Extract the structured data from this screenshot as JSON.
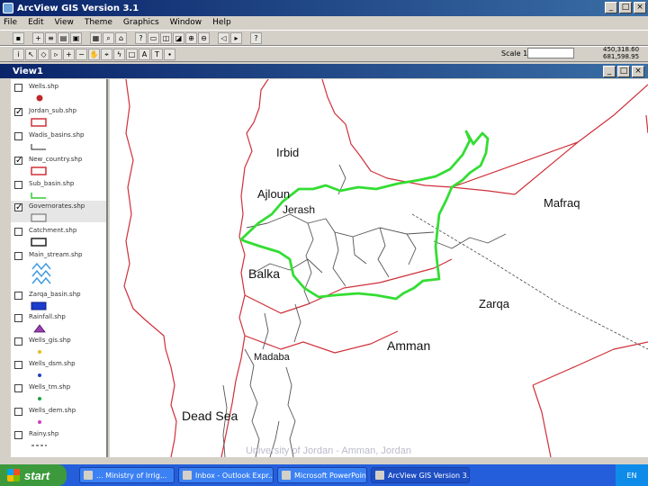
{
  "window": {
    "title": "ArcView GIS Version 3.1"
  },
  "menu": [
    "File",
    "Edit",
    "View",
    "Theme",
    "Graphics",
    "Window",
    "Help"
  ],
  "toolbar": {
    "scale_label": "Scale 1:",
    "coords": [
      "450,318.60",
      "681,598.95"
    ]
  },
  "view": {
    "title": "View1"
  },
  "layers": [
    {
      "label": "Wells.shp",
      "checked": false,
      "symbol": "red-dot"
    },
    {
      "label": "Jordan_sub.shp",
      "checked": true,
      "symbol": "red-rect"
    },
    {
      "label": "Wadis_basins.shp",
      "checked": false,
      "symbol": "black-line"
    },
    {
      "label": "New_country.shp",
      "checked": true,
      "symbol": "red-rect"
    },
    {
      "label": "Sub_basin.shp",
      "checked": false,
      "symbol": "green-line"
    },
    {
      "label": "Governorates.shp",
      "checked": true,
      "symbol": "gray-rect"
    },
    {
      "label": "Catchment.shp",
      "checked": false,
      "symbol": "black-rect"
    },
    {
      "label": "Main_stream.shp",
      "checked": false,
      "symbol": "blue-wave"
    },
    {
      "label": "Zarqa_basin.shp",
      "checked": false,
      "symbol": "blue-fill"
    },
    {
      "label": "Rainfall.shp",
      "checked": false,
      "symbol": "purple-triangle"
    },
    {
      "label": "Wells_gis.shp",
      "checked": false,
      "symbol": "yellow-dot"
    },
    {
      "label": "Wells_dsm.shp",
      "checked": false,
      "symbol": "blue-dot"
    },
    {
      "label": "Wells_tm.shp",
      "checked": false,
      "symbol": "green-dot"
    },
    {
      "label": "Wells_dem.shp",
      "checked": false,
      "symbol": "magenta-dot"
    },
    {
      "label": "Rainy.shp",
      "checked": false,
      "symbol": "dashed-line"
    }
  ],
  "map": {
    "places": {
      "irbid": "Irbid",
      "ajloun": "Ajloun",
      "jerash": "Jerash",
      "mafraq": "Mafraq",
      "balka": "Balka",
      "zarqa": "Zarqa",
      "amman": "Amman",
      "madaba": "Madaba",
      "dead_sea": "Dead Sea"
    },
    "colors": {
      "boundary": "#d0303a",
      "basin": "#33dd33",
      "subdivision": "#555555"
    }
  },
  "watermark": "University of Jordan - Amman, Jordan",
  "taskbar": {
    "start": "start",
    "tasks": [
      "... Ministry of Irrig...",
      "Inbox - Outlook Expr...",
      "Microsoft PowerPoint...",
      "ArcView GIS Version 3.1"
    ],
    "tray": "EN"
  }
}
